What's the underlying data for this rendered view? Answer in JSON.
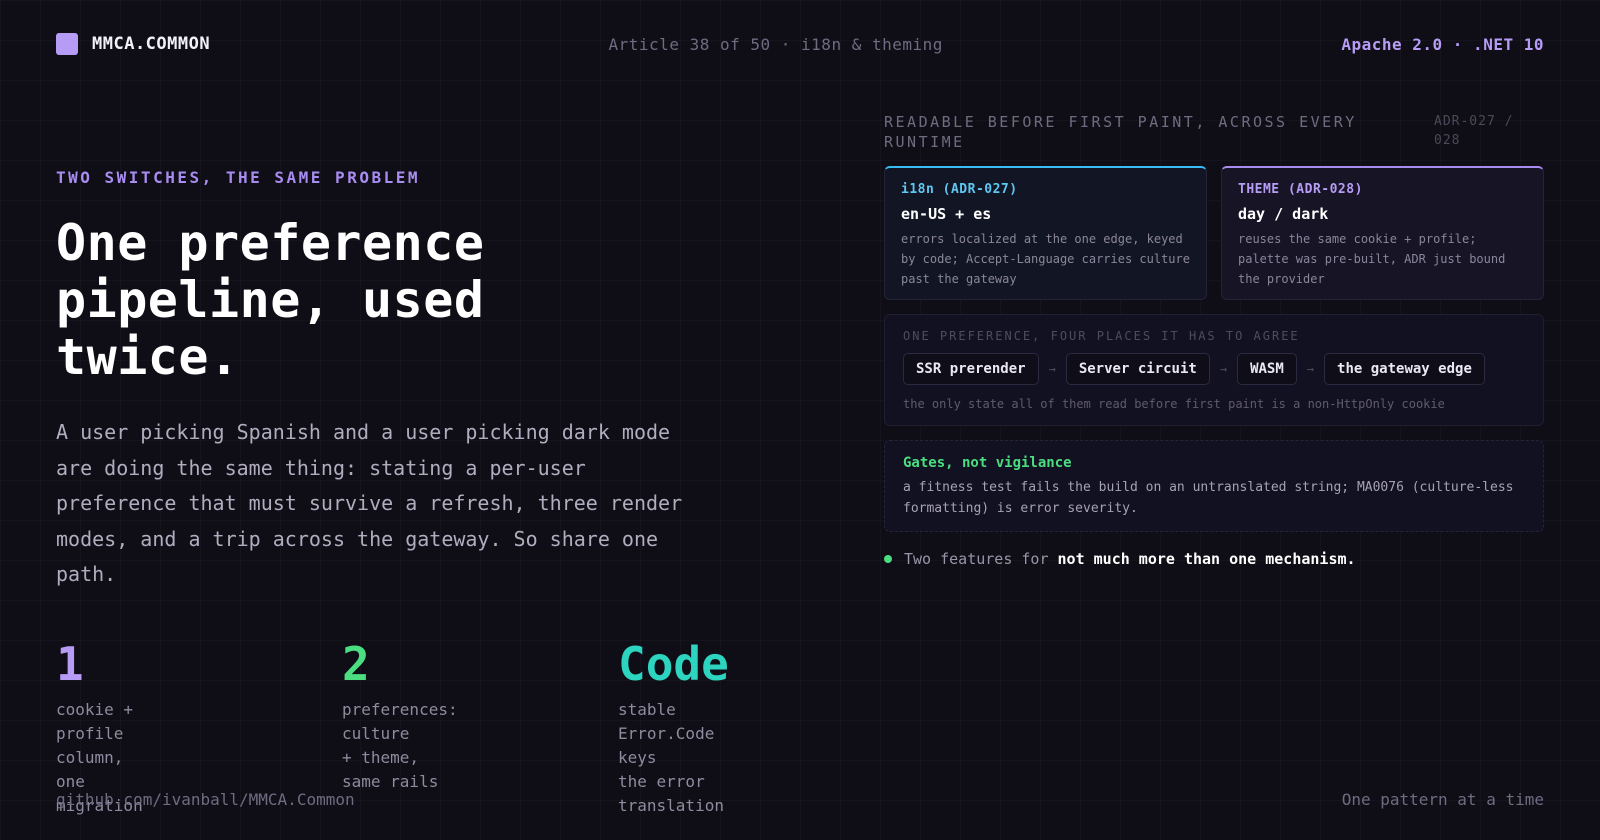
{
  "header": {
    "brand": "MMCA.COMMON",
    "center": "Article 38 of 50 · i18n & theming",
    "right": "Apache 2.0 · .NET 10"
  },
  "hero": {
    "eyebrow": "TWO SWITCHES, THE SAME PROBLEM",
    "headline": "One preference pipeline, used twice.",
    "lede": "A user picking Spanish and a user picking dark mode are doing the same thing: stating a per-user preference that must survive a refresh, three render modes, and a trip across the gateway. So share one path."
  },
  "stats": [
    {
      "value": "1",
      "caption": "cookie + profile\ncolumn, one migration",
      "color": "#b69cf5"
    },
    {
      "value": "2",
      "caption": "preferences: culture\n+ theme, same rails",
      "color": "#4ade80"
    },
    {
      "value": "Code",
      "caption": "stable Error.Code keys\nthe error translation",
      "color": "#2dd4bf"
    }
  ],
  "panel": {
    "title": "READABLE BEFORE FIRST PAINT, ACROSS EVERY RUNTIME",
    "ref": "ADR-027 / 028",
    "cards": [
      {
        "label": "i18n (ADR-027)",
        "title": "en-US + es",
        "desc": "errors localized at the one edge, keyed by code; Accept-Language carries culture past the gateway"
      },
      {
        "label": "THEME (ADR-028)",
        "title": "day / dark",
        "desc": "reuses the same cookie + profile; palette was pre-built, ADR just bound the provider"
      }
    ],
    "flow": {
      "title": "ONE PREFERENCE, FOUR PLACES IT HAS TO AGREE",
      "steps": [
        "SSR prerender",
        "Server circuit",
        "WASM",
        "the gateway edge"
      ],
      "arrow": "→",
      "note": "the only state all of them read before first paint is a non-HttpOnly cookie"
    },
    "gates": {
      "title": "Gates, not vigilance",
      "desc": "a fitness test fails the build on an untranslated string; MA0076 (culture-less formatting) is error severity."
    },
    "summary": {
      "text": "Two features for",
      "strong": "not much more than one mechanism."
    }
  },
  "footer": {
    "left": "github.com/ivanball/MMCA.Common",
    "right": "One pattern at a time"
  }
}
